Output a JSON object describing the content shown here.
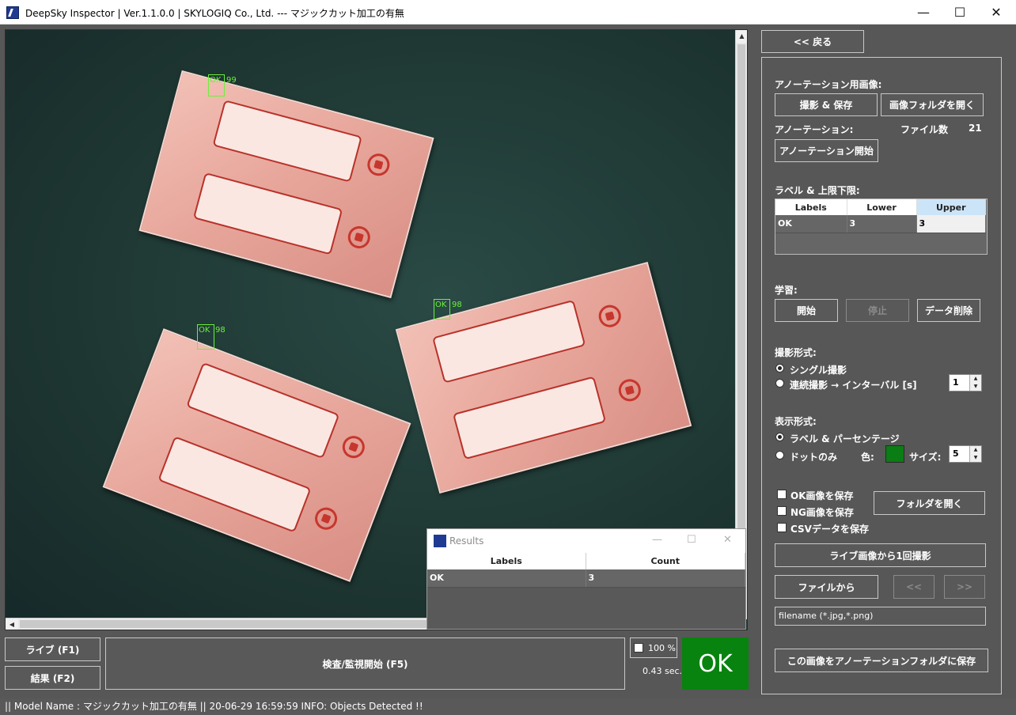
{
  "window": {
    "title": "DeepSky Inspector | Ver.1.1.0.0 | SKYLOGIQ Co., Ltd. --- マジックカット加工の有無",
    "minimize": "—",
    "maximize": "☐",
    "close": "✕"
  },
  "viewer": {
    "detections": [
      {
        "label": "OK",
        "score": "99"
      },
      {
        "label": "OK",
        "score": "98"
      },
      {
        "label": "OK",
        "score": "98"
      }
    ]
  },
  "results_window": {
    "title": "Results",
    "columns": [
      "Labels",
      "Count"
    ],
    "rows": [
      [
        "OK",
        "3"
      ]
    ]
  },
  "bottom": {
    "live_button": "ライブ (F1)",
    "results_button": "結果 (F2)",
    "start_inspection_button": "検査/監視開始 (F5)",
    "zoom_label": "100 %",
    "elapsed": "0.43 sec.",
    "result": "OK",
    "result_color": "#08830f"
  },
  "status_bar": "|| Model Name : マジックカット加工の有無 ||    20-06-29 16:59:59   INFO:   Objects Detected !!",
  "side": {
    "back_button": "<< 戻る",
    "annotation_images_label": "アノーテーション用画像:",
    "capture_save_button": "撮影 & 保存",
    "open_image_folder_button": "画像フォルダを開く",
    "annotation_label": "アノーテーション:",
    "file_count_label": "ファイル数",
    "file_count_value": "21",
    "start_annotation_button": "アノーテーション開始",
    "label_limits_label": "ラベル & 上限下限:",
    "labels_table": {
      "columns": [
        "Labels",
        "Lower",
        "Upper"
      ],
      "rows": [
        [
          "OK",
          "3",
          "3"
        ]
      ]
    },
    "learning_label": "学習:",
    "learn_start_button": "開始",
    "learn_stop_button": "停止",
    "delete_data_button": "データ削除",
    "capture_mode_label": "撮影形式:",
    "single_capture": "シングル撮影",
    "continuous_capture": "連続撮影 → インターバル [s]",
    "interval_value": "1",
    "display_mode_label": "表示形式:",
    "label_percentage": "ラベル & パーセンテージ",
    "dots_only": "ドットのみ",
    "color_label": "色:",
    "dot_color": "#0a7d14",
    "size_label": "サイズ:",
    "size_value": "5",
    "save_ok_images": "OK画像を保存",
    "save_ng_images": "NG画像を保存",
    "save_csv": "CSVデータを保存",
    "open_folder_button": "フォルダを開く",
    "capture_once_button": "ライブ画像から1回撮影",
    "from_file_button": "ファイルから",
    "prev_button": "<<",
    "next_button": ">>",
    "filename_placeholder": "filename (*.jpg,*.png)",
    "save_to_annotation_button": "この画像をアノーテーションフォルダに保存"
  }
}
